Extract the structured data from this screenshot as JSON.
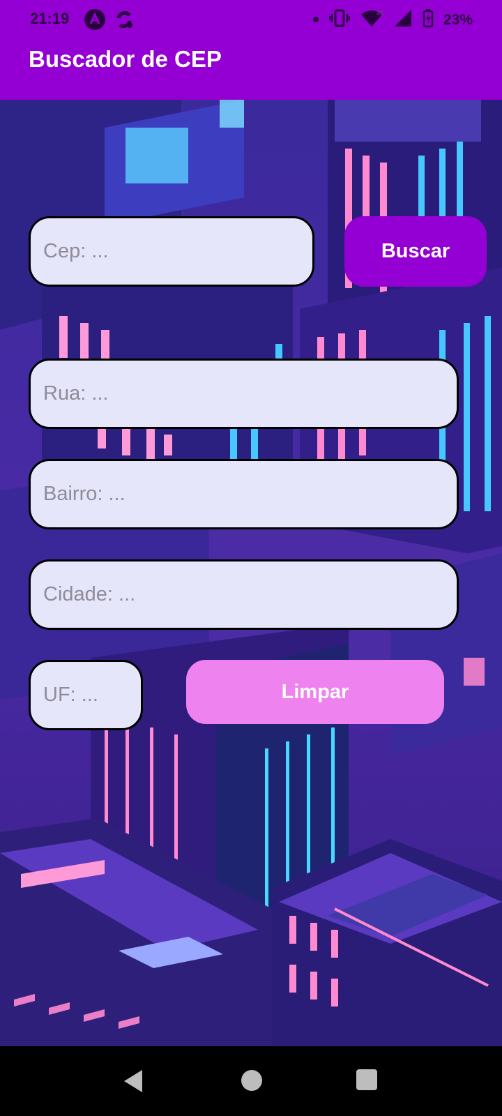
{
  "status_bar": {
    "time": "21:19",
    "battery": "23%",
    "icons": [
      "app-icon-a",
      "sync-icon",
      "dot-icon",
      "vibrate-icon",
      "wifi-icon",
      "signal-icon",
      "battery-icon"
    ]
  },
  "app_bar": {
    "title": "Buscador de CEP"
  },
  "form": {
    "cep_placeholder": "Cep: ...",
    "search_label": "Buscar",
    "street_placeholder": "Rua: ...",
    "district_placeholder": "Bairro: ...",
    "city_placeholder": "Cidade: ...",
    "state_placeholder": "UF: ...",
    "clear_label": "Limpar"
  },
  "colors": {
    "primary": "#9400d3",
    "input_bg": "#e6e6fa",
    "clear_button": "#ee82ee"
  },
  "nav_bar": {
    "icons": [
      "back-icon",
      "home-icon",
      "recents-icon"
    ]
  }
}
